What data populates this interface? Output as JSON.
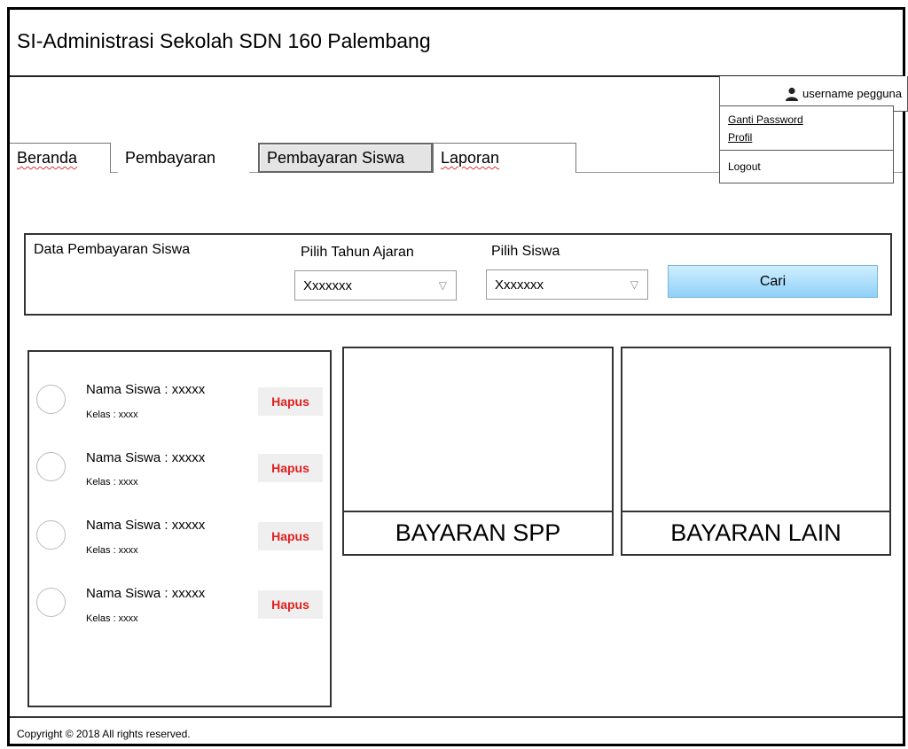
{
  "header": {
    "title": "SI-Administrasi Sekolah SDN 160 Palembang"
  },
  "user": {
    "icon": "user-icon",
    "name": "username pegguna",
    "menu": {
      "change_password": "Ganti Password",
      "profile": "Profil",
      "logout": "Logout"
    }
  },
  "nav": {
    "tabs": [
      {
        "label": "Beranda"
      },
      {
        "label": "Pembayaran"
      },
      {
        "label": "Pembayaran Siswa",
        "active": true
      },
      {
        "label": "Laporan"
      }
    ]
  },
  "search": {
    "section_label": "Data Pembayaran Siswa",
    "year_label": "Pilih Tahun Ajaran",
    "year_value": "Xxxxxxx",
    "student_label": "Pilih Siswa",
    "student_value": "Xxxxxxx",
    "search_button": "Cari"
  },
  "students": [
    {
      "name": "Nama Siswa : xxxxx",
      "class": "Kelas : xxxx",
      "delete": "Hapus"
    },
    {
      "name": "Nama Siswa : xxxxx",
      "class": "Kelas : xxxx",
      "delete": "Hapus"
    },
    {
      "name": "Nama Siswa : xxxxx",
      "class": "Kelas : xxxx",
      "delete": "Hapus"
    },
    {
      "name": "Nama Siswa : xxxxx",
      "class": "Kelas : xxxx",
      "delete": "Hapus"
    }
  ],
  "payment_cards": [
    {
      "label": "BAYARAN SPP"
    },
    {
      "label": "BAYARAN LAIN"
    }
  ],
  "footer": {
    "copyright": "Copyright © 2018  All rights reserved."
  },
  "colors": {
    "accent_button": "#8fd0f7",
    "danger_text": "#e02020"
  }
}
